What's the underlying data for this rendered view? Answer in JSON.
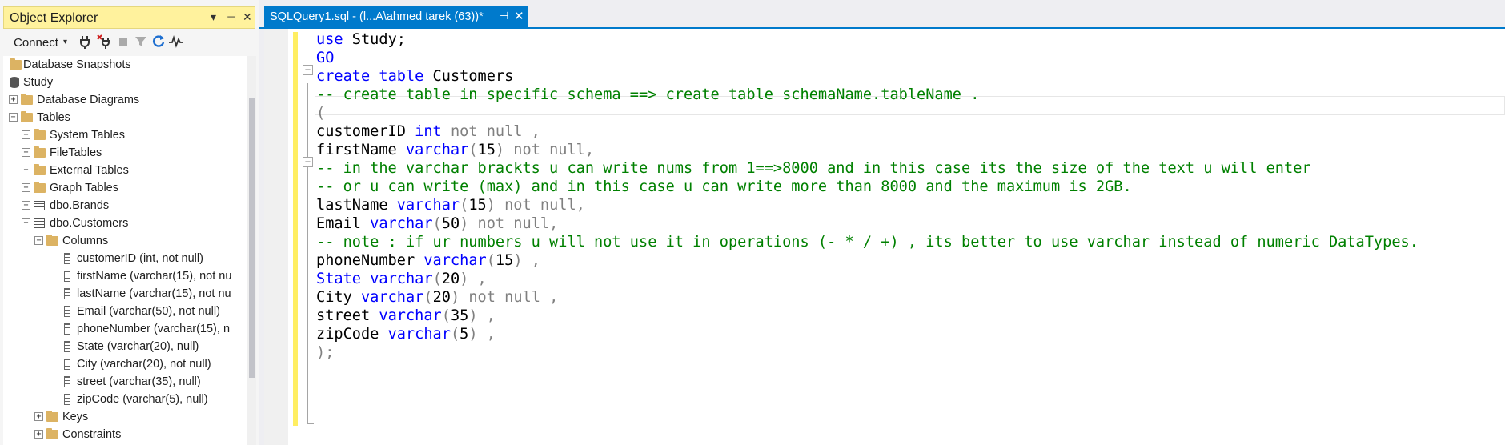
{
  "object_explorer": {
    "title": "Object Explorer",
    "title_buttons": {
      "dropdown": "▾",
      "pin": "⊣",
      "close": "✕"
    },
    "toolbar": {
      "connect_label": "Connect",
      "caret": "▾"
    },
    "tree": [
      {
        "label": "Database Snapshots",
        "icon": "folder-icon",
        "expander": ""
      },
      {
        "label": "Study",
        "icon": "database-icon",
        "expander": ""
      },
      {
        "label": "Database Diagrams",
        "icon": "folder-icon",
        "expander": "+"
      },
      {
        "label": "Tables",
        "icon": "folder-icon",
        "expander": "−"
      },
      {
        "label": "System Tables",
        "icon": "folder-icon",
        "expander": "+"
      },
      {
        "label": "FileTables",
        "icon": "folder-icon",
        "expander": "+"
      },
      {
        "label": "External Tables",
        "icon": "folder-icon",
        "expander": "+"
      },
      {
        "label": "Graph Tables",
        "icon": "folder-icon",
        "expander": "+"
      },
      {
        "label": "dbo.Brands",
        "icon": "table-icon",
        "expander": "+"
      },
      {
        "label": "dbo.Customers",
        "icon": "table-icon",
        "expander": "−"
      },
      {
        "label": "Columns",
        "icon": "folder-icon",
        "expander": "−"
      },
      {
        "label": "customerID (int, not null)",
        "icon": "column-icon",
        "expander": ""
      },
      {
        "label": "firstName (varchar(15), not nu",
        "icon": "column-icon",
        "expander": ""
      },
      {
        "label": "lastName (varchar(15), not nu",
        "icon": "column-icon",
        "expander": ""
      },
      {
        "label": "Email (varchar(50), not null)",
        "icon": "column-icon",
        "expander": ""
      },
      {
        "label": "phoneNumber (varchar(15), n",
        "icon": "column-icon",
        "expander": ""
      },
      {
        "label": "State (varchar(20), null)",
        "icon": "column-icon",
        "expander": ""
      },
      {
        "label": "City (varchar(20), not null)",
        "icon": "column-icon",
        "expander": ""
      },
      {
        "label": "street (varchar(35), null)",
        "icon": "column-icon",
        "expander": ""
      },
      {
        "label": "zipCode (varchar(5), null)",
        "icon": "column-icon",
        "expander": ""
      },
      {
        "label": "Keys",
        "icon": "folder-icon",
        "expander": "+"
      },
      {
        "label": "Constraints",
        "icon": "folder-icon",
        "expander": "+"
      }
    ]
  },
  "editor": {
    "tab": {
      "title": "SQLQuery1.sql - (l...A\\ahmed tarek (63))*",
      "pin": "⊣",
      "close": "✕"
    },
    "fold_markers": {
      "collapse": "−"
    },
    "lines": [
      [
        [
          "kw",
          "use"
        ],
        [
          "",
          " Study;"
        ]
      ],
      [
        [
          "kw",
          "GO"
        ]
      ],
      [
        [
          "kw",
          "create"
        ],
        [
          "",
          " "
        ],
        [
          "kw",
          "table"
        ],
        [
          "",
          " Customers"
        ]
      ],
      [
        [
          "cm",
          "-- create table in specific schema ==> create table schemaName.tableName ."
        ]
      ],
      [
        [
          "gr",
          "("
        ]
      ],
      [
        [
          "",
          "customerID "
        ],
        [
          "kw",
          "int"
        ],
        [
          "",
          " "
        ],
        [
          "gr",
          "not null ,"
        ]
      ],
      [
        [
          "",
          "firstName "
        ],
        [
          "kw",
          "varchar"
        ],
        [
          "gr",
          "("
        ],
        [
          "",
          "15"
        ],
        [
          "gr",
          ") not null,"
        ]
      ],
      [
        [
          "cm",
          "-- in the varchar brackts u can write nums from 1==>8000 and in this case its the size of the text u will enter"
        ]
      ],
      [
        [
          "cm",
          "-- or u can write (max) and in this case u can write more than 8000 and the maximum is 2GB."
        ]
      ],
      [
        [
          "",
          "lastName "
        ],
        [
          "kw",
          "varchar"
        ],
        [
          "gr",
          "("
        ],
        [
          "",
          "15"
        ],
        [
          "gr",
          ") not null,"
        ]
      ],
      [
        [
          "",
          "Email "
        ],
        [
          "kw",
          "varchar"
        ],
        [
          "gr",
          "("
        ],
        [
          "",
          "50"
        ],
        [
          "gr",
          ") not null,"
        ]
      ],
      [
        [
          "cm",
          "-- note : if ur numbers u will not use it in operations (- * / +) , its better to use varchar instead of numeric DataTypes."
        ]
      ],
      [
        [
          "",
          "phoneNumber "
        ],
        [
          "kw",
          "varchar"
        ],
        [
          "gr",
          "("
        ],
        [
          "",
          "15"
        ],
        [
          "gr",
          ") ,"
        ]
      ],
      [
        [
          "kw",
          "State"
        ],
        [
          "",
          " "
        ],
        [
          "kw",
          "varchar"
        ],
        [
          "gr",
          "("
        ],
        [
          "",
          "20"
        ],
        [
          "gr",
          ") ,"
        ]
      ],
      [
        [
          "",
          "City "
        ],
        [
          "kw",
          "varchar"
        ],
        [
          "gr",
          "("
        ],
        [
          "",
          "20"
        ],
        [
          "gr",
          ") not null ,"
        ]
      ],
      [
        [
          "",
          "street "
        ],
        [
          "kw",
          "varchar"
        ],
        [
          "gr",
          "("
        ],
        [
          "",
          "35"
        ],
        [
          "gr",
          ") ,"
        ]
      ],
      [
        [
          "",
          "zipCode "
        ],
        [
          "kw",
          "varchar"
        ],
        [
          "gr",
          "("
        ],
        [
          "",
          "5"
        ],
        [
          "gr",
          ") ,"
        ]
      ],
      [
        [
          "gr",
          ");"
        ]
      ]
    ]
  }
}
